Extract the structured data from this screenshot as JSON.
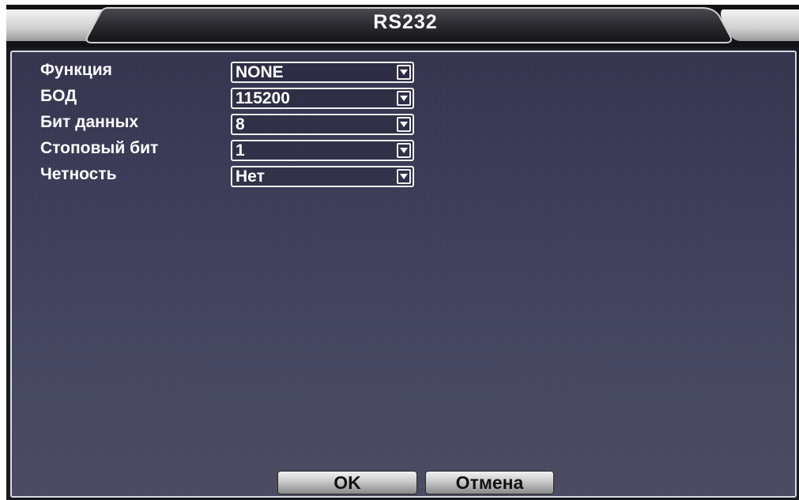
{
  "window": {
    "title": "RS232"
  },
  "form": {
    "rows": [
      {
        "label": "Функция",
        "value": "NONE"
      },
      {
        "label": "БОД",
        "value": "115200"
      },
      {
        "label": "Бит данных",
        "value": "8"
      },
      {
        "label": "Стоповый бит",
        "value": "1"
      },
      {
        "label": "Четность",
        "value": "Нет"
      }
    ]
  },
  "buttons": {
    "ok_label": "OK",
    "cancel_label": "Отмена"
  },
  "colors": {
    "panel_background": "#3d3d5a",
    "titlebar": "#1a1a22",
    "text": "#ffffff"
  },
  "icons": {
    "dropdown": "chevron-down-icon"
  }
}
